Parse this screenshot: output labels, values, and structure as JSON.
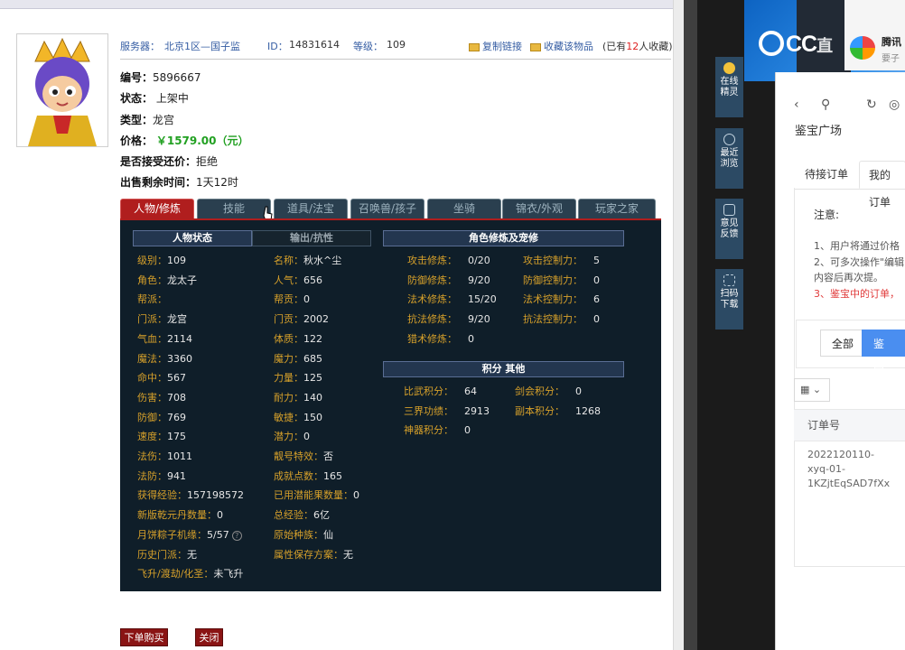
{
  "listing": {
    "server_label": "服务器：",
    "server": "北京1区—国子监",
    "id_label": "ID：",
    "id": "14831614",
    "level_label": "等级：",
    "level": "109",
    "copy_link": "复制链接",
    "favorite": "收藏该物品",
    "fav_count_pre": "(已有",
    "fav_count": "12",
    "fav_count_post": "人收藏)",
    "number_label": "编号：",
    "number": "5896667",
    "status_label": "状态：",
    "status": "上架中",
    "type_label": "类型：",
    "type": "龙宫",
    "price_label": "价格：",
    "price": "￥1579.00（元）",
    "bargain_label": "是否接受还价：",
    "bargain": "拒绝",
    "remaining_label": "出售剩余时间：",
    "remaining": "1天12时"
  },
  "tabs": [
    "人物/修炼",
    "技能",
    "道具/法宝",
    "召唤兽/孩子",
    "坐骑",
    "锦衣/外观",
    "玩家之家"
  ],
  "section_headers": {
    "status": "人物状态",
    "output": "输出/抗性",
    "cultivation": "角色修炼及宠修",
    "points": "积分  其他"
  },
  "stats_col1": [
    {
      "k": "级别：",
      "v": "109"
    },
    {
      "k": "角色：",
      "v": "龙太子"
    },
    {
      "k": "帮派：",
      "v": ""
    },
    {
      "k": "门派：",
      "v": "龙宫"
    },
    {
      "k": "气血：",
      "v": "2114"
    },
    {
      "k": "魔法：",
      "v": "3360"
    },
    {
      "k": "命中：",
      "v": "567"
    },
    {
      "k": "伤害：",
      "v": "708"
    },
    {
      "k": "防御：",
      "v": "769"
    },
    {
      "k": "速度：",
      "v": "175"
    },
    {
      "k": "法伤：",
      "v": "1011"
    },
    {
      "k": "法防：",
      "v": "941"
    },
    {
      "k": "获得经验：",
      "v": "157198572"
    },
    {
      "k": "新版乾元丹数量：",
      "v": "0"
    },
    {
      "k": "月饼粽子机缘：",
      "v": "5/57"
    },
    {
      "k": "历史门派：",
      "v": "无"
    },
    {
      "k": "飞升/渡劫/化圣：",
      "v": "未飞升"
    }
  ],
  "stats_col2": [
    {
      "k": "名称：",
      "v": "秋水^尘"
    },
    {
      "k": "人气：",
      "v": "656"
    },
    {
      "k": "帮贡：",
      "v": "0"
    },
    {
      "k": "门贡：",
      "v": "2002"
    },
    {
      "k": "体质：",
      "v": "122"
    },
    {
      "k": "魔力：",
      "v": "685"
    },
    {
      "k": "力量：",
      "v": "125"
    },
    {
      "k": "耐力：",
      "v": "140"
    },
    {
      "k": "敏捷：",
      "v": "150"
    },
    {
      "k": "潜力：",
      "v": "0"
    },
    {
      "k": "靓号特效：",
      "v": "否"
    },
    {
      "k": "成就点数：",
      "v": "165"
    },
    {
      "k": "已用潜能果数量：",
      "v": "0"
    },
    {
      "k": "总经验：",
      "v": "6亿"
    },
    {
      "k": "原始种族：",
      "v": "仙"
    },
    {
      "k": "属性保存方案：",
      "v": "无"
    }
  ],
  "cultivation_col1": [
    {
      "k": "攻击修炼：",
      "v": "0/20"
    },
    {
      "k": "防御修炼：",
      "v": "9/20"
    },
    {
      "k": "法术修炼：",
      "v": "15/20"
    },
    {
      "k": "抗法修炼：",
      "v": "9/20"
    },
    {
      "k": "猎术修炼：",
      "v": "0"
    }
  ],
  "cultivation_col2": [
    {
      "k": "攻击控制力：",
      "v": "5"
    },
    {
      "k": "防御控制力：",
      "v": "0"
    },
    {
      "k": "法术控制力：",
      "v": "6"
    },
    {
      "k": "抗法控制力：",
      "v": "0"
    }
  ],
  "points_col1": [
    {
      "k": "比武积分：",
      "v": "64"
    },
    {
      "k": "三界功绩：",
      "v": "2913"
    },
    {
      "k": "神器积分：",
      "v": "0"
    }
  ],
  "points_col2": [
    {
      "k": "剑会积分：",
      "v": "0"
    },
    {
      "k": "副本积分：",
      "v": "1268"
    }
  ],
  "buttons": {
    "buy": "下单购买",
    "close": "关闭"
  },
  "sidebar": [
    {
      "label1": "在线",
      "label2": "精灵"
    },
    {
      "label1": "最近",
      "label2": "浏览"
    },
    {
      "label1": "意见",
      "label2": "反馈"
    },
    {
      "label1": "扫码",
      "label2": "下载"
    }
  ],
  "overlay": {
    "cc_logo_text": "CC",
    "cc_logo_suffix": "直",
    "tencent_title": "腾讯",
    "tencent_sub": "要子"
  },
  "appraisal": {
    "title": "鉴宝广场",
    "tab_pending": "待接订单",
    "tab_mine": "我的订单",
    "note_title": "注意:",
    "note_1": "1、用户将通过价格",
    "note_2": "2、可多次操作\"编辑",
    "note_2b": "内容后再次提。",
    "note_3": "3、鉴宝中的订单，",
    "filter_all": "全部",
    "filter_active": "鉴宝中",
    "col_order": "订单号",
    "order_line1": "2022120110-",
    "order_line2": "xyq-01-",
    "order_line3": "1KZjtEqSAD7fXx"
  },
  "colors": {
    "accent_red": "#b01e1e",
    "panel_bg": "#0f1e29",
    "label_gold": "#d6a02a",
    "link_blue": "#355da3",
    "price_green": "#21a021",
    "cc_blue": "#1a75d8"
  }
}
